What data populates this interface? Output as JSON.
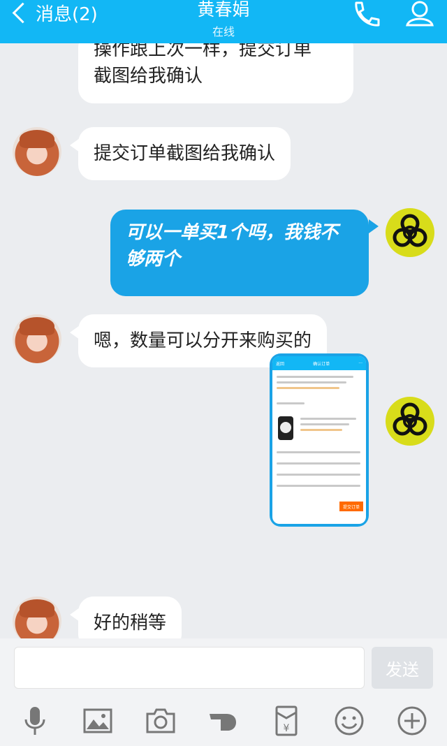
{
  "header": {
    "back_label": "消息(2)",
    "contact_name": "黄春娟",
    "status": "在线",
    "phone_icon": "phone-icon",
    "profile_icon": "contact-profile-icon"
  },
  "colors": {
    "header": "#12b7f5",
    "outgoing_bubble": "#1aa3e6",
    "background": "#ebedf0"
  },
  "messages": [
    {
      "from": "contact",
      "text_line1": "操作跟上次一样，提交订单",
      "text_line2": "截图给我确认"
    },
    {
      "from": "contact",
      "text": "提交订单截图给我确认"
    },
    {
      "from": "me",
      "text_line1": "可以一单买1个吗，我钱不",
      "text_line2": "够两个"
    },
    {
      "from": "contact",
      "text": "嗯，数量可以分开来购买的"
    },
    {
      "from": "me",
      "type": "image",
      "image_title": "确认订单",
      "image_back": "返回",
      "image_submit": "提交订单"
    },
    {
      "from": "contact",
      "text": "好的稍等"
    }
  ],
  "input": {
    "placeholder": "",
    "send_label": "发送"
  },
  "toolbar": [
    "microphone-icon",
    "image-icon",
    "camera-icon",
    "hand-icon",
    "red-packet-icon",
    "emoji-icon",
    "plus-icon"
  ]
}
